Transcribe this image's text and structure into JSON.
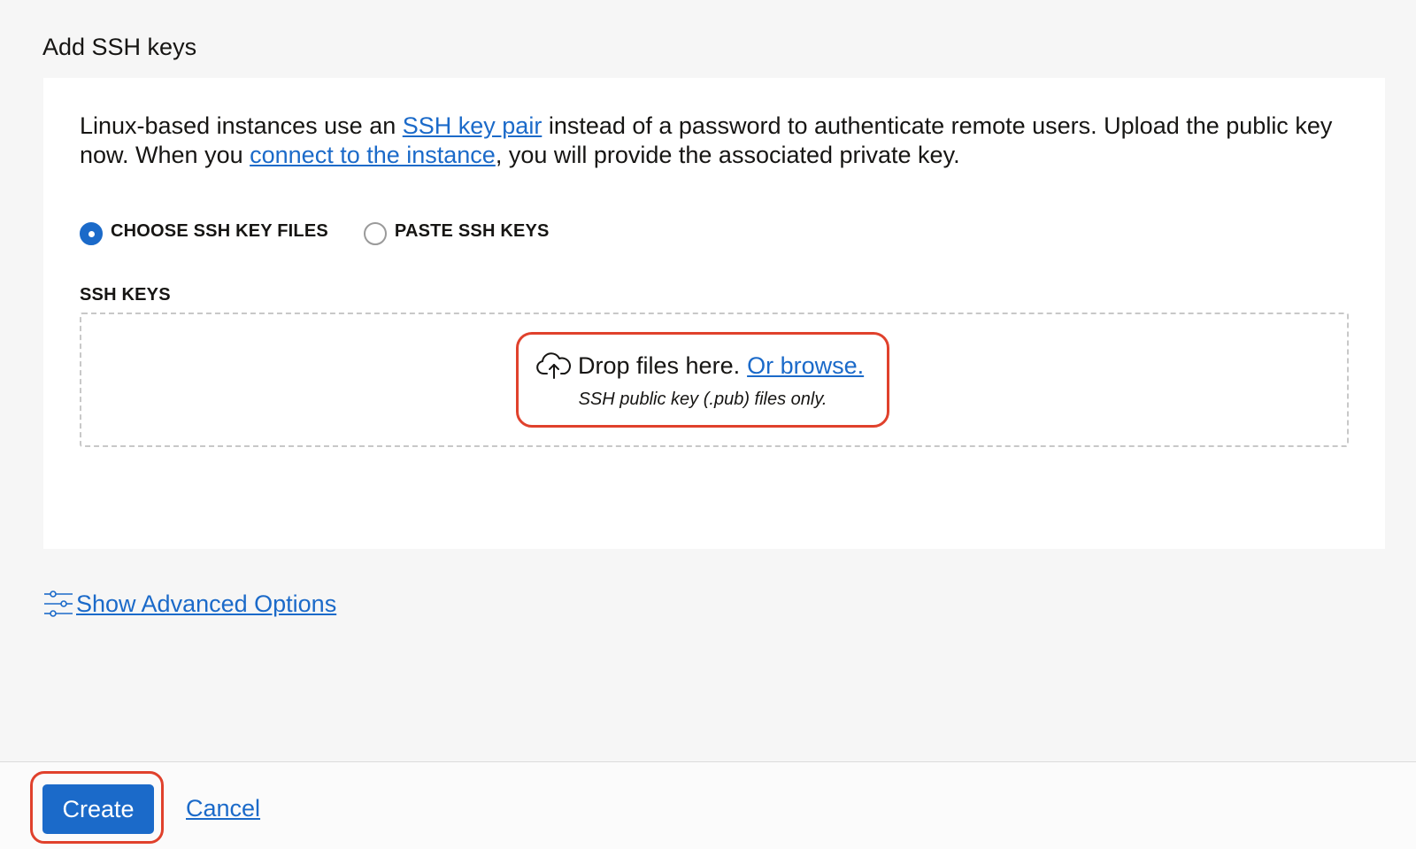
{
  "section": {
    "title": "Add SSH keys"
  },
  "description": {
    "part1": "Linux-based instances use an ",
    "link1": "SSH key pair",
    "part2": " instead of a password to authenticate remote users. Upload the public key now. When you ",
    "link2": "connect to the instance",
    "part3": ", you will provide the associated private key."
  },
  "radio_options": [
    {
      "label": "CHOOSE SSH KEY FILES",
      "checked": true
    },
    {
      "label": "PASTE SSH KEYS",
      "checked": false
    }
  ],
  "ssh_keys": {
    "label": "SSH KEYS",
    "drop_text": "Drop files here.",
    "browse_link": "Or browse.",
    "hint": "SSH public key (.pub) files only."
  },
  "advanced": {
    "label": "Show Advanced Options"
  },
  "footer": {
    "create_label": "Create",
    "cancel_label": "Cancel"
  },
  "colors": {
    "accent": "#1b6ac9",
    "highlight": "#e0412c",
    "background": "#f6f6f6"
  },
  "icons": {
    "upload": "cloud-upload-icon",
    "advanced": "sliders-icon"
  }
}
